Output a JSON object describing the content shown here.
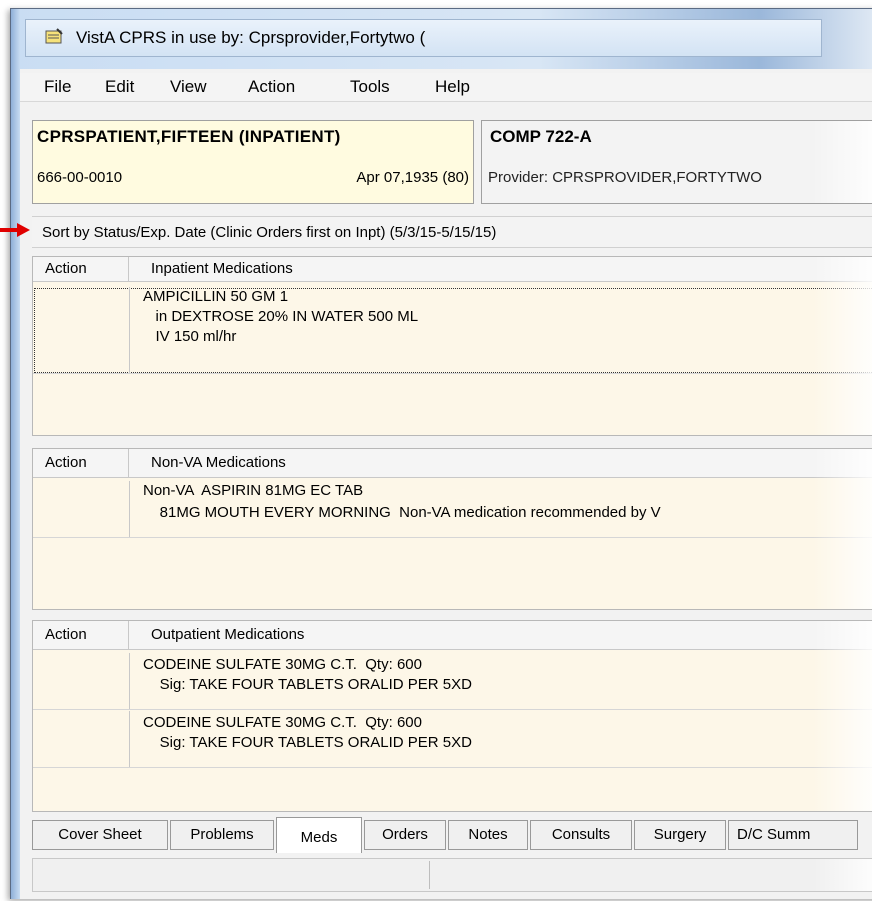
{
  "window": {
    "title": "VistA CPRS in use by: Cprsprovider,Fortytwo  ("
  },
  "menu": [
    "File",
    "Edit",
    "View",
    "Action",
    "Tools",
    "Help"
  ],
  "patient": {
    "name": "CPRSPATIENT,FIFTEEN (INPATIENT)",
    "ssn": "666-00-0010",
    "dob": "Apr 07,1935 (80)"
  },
  "location": {
    "name": "COMP 722-A",
    "provider": "Provider:  CPRSPROVIDER,FORTYTWO"
  },
  "sort_text": "Sort by Status/Exp. Date (Clinic Orders first on Inpt)  (5/3/15-5/15/15)",
  "inpatient": {
    "action_header": "Action",
    "title": "Inpatient Medications",
    "rows": [
      [
        "AMPICILLIN 50 GM 1",
        "   in DEXTROSE 20% IN WATER 500 ML",
        "   IV 150 ml/hr"
      ]
    ]
  },
  "nonva": {
    "action_header": "Action",
    "title": "Non-VA Medications",
    "rows": [
      [
        "Non-VA  ASPIRIN 81MG EC TAB",
        "    81MG MOUTH EVERY MORNING  Non-VA medication recommended by V"
      ]
    ]
  },
  "outpatient": {
    "action_header": "Action",
    "title": "Outpatient Medications",
    "rows": [
      [
        "CODEINE SULFATE 30MG C.T.  Qty: 600",
        "    Sig: TAKE FOUR TABLETS ORALID PER 5XD"
      ],
      [
        "CODEINE SULFATE 30MG C.T.  Qty: 600",
        "    Sig: TAKE FOUR TABLETS ORALID PER 5XD"
      ]
    ]
  },
  "tabs": [
    "Cover Sheet",
    "Problems",
    "Meds",
    "Orders",
    "Notes",
    "Consults",
    "Surgery",
    "D/C Summ"
  ],
  "active_tab": "Meds",
  "colors": {
    "accent_arrow": "#e00000",
    "pane_background": "#fdf7e8",
    "patient_background": "#fffbe0"
  }
}
